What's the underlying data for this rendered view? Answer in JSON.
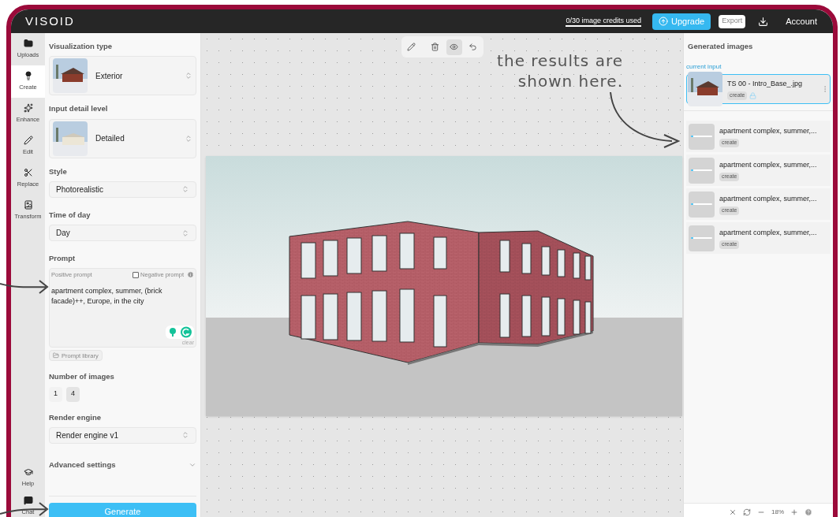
{
  "header": {
    "logo": "VISOID",
    "credits": "0/30 image credits used",
    "upgrade": "Upgrade",
    "export": "Export",
    "account": "Account"
  },
  "rail": [
    {
      "label": "Uploads",
      "selected": false
    },
    {
      "label": "Create",
      "selected": true
    },
    {
      "label": "Enhance",
      "selected": false
    },
    {
      "label": "Edit",
      "selected": false
    },
    {
      "label": "Replace",
      "selected": false
    },
    {
      "label": "Transform",
      "selected": false
    }
  ],
  "rail_bottom": [
    {
      "label": "Help"
    },
    {
      "label": "Chat"
    }
  ],
  "panel": {
    "visualization_type": {
      "label": "Visualization type",
      "value": "Exterior"
    },
    "input_detail": {
      "label": "Input detail level",
      "value": "Detailed"
    },
    "style": {
      "label": "Style",
      "value": "Photorealistic"
    },
    "time_of_day": {
      "label": "Time of day",
      "value": "Day"
    },
    "prompt": {
      "label": "Prompt",
      "tab": "Positive prompt",
      "negative_label": "Negative prompt",
      "negative_checked": false,
      "value": "apartment complex, summer, (brick facade)++, Europe, in the city",
      "clear": "clear",
      "library": "Prompt library"
    },
    "number_of_images": {
      "label": "Number of images",
      "options": [
        {
          "label": "1",
          "selected": false
        },
        {
          "label": "4",
          "selected": true
        }
      ]
    },
    "render_engine": {
      "label": "Render engine",
      "value": "Render engine v1"
    },
    "advanced": {
      "label": "Advanced settings",
      "expanded": false
    },
    "generate": "Generate"
  },
  "toolbar": [
    {
      "selected": false
    },
    {
      "selected": false
    },
    {
      "selected": true
    },
    {
      "selected": false
    }
  ],
  "annotation": "the results are shown here.",
  "generated": {
    "title": "Generated images",
    "current_label": "current input",
    "current": {
      "name": "TS 00 - Intro_Base_.jpg",
      "tag": "create"
    },
    "items": [
      {
        "title": "apartment complex, summer,...",
        "tag": "create",
        "level": 0.1
      },
      {
        "title": "apartment complex, summer,...",
        "tag": "create",
        "level": 0.1
      },
      {
        "title": "apartment complex, summer,...",
        "tag": "create",
        "level": 0.1
      },
      {
        "title": "apartment complex, summer,...",
        "tag": "create",
        "level": 0.1
      }
    ]
  },
  "bottom_bar": {
    "zoom": "18%"
  }
}
